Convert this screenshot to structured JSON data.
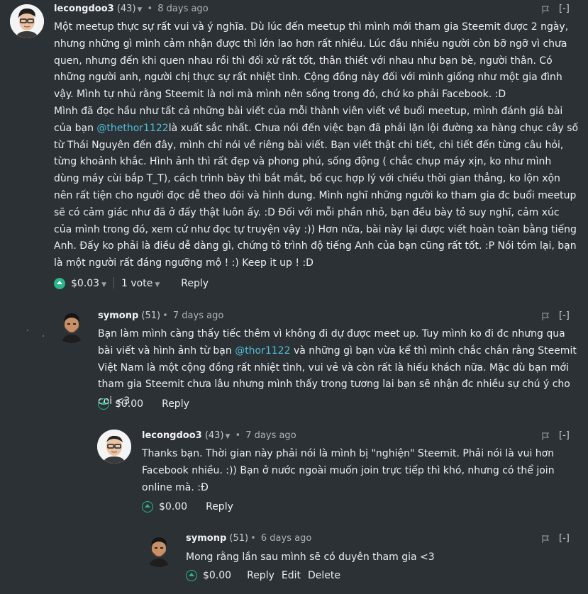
{
  "comments": [
    {
      "author": "lecongdoo3",
      "reputation": "(43)",
      "time": "8 days ago",
      "collapse": "[-]",
      "body": [
        "Một meetup thực sự rất vui và ý nghĩa. Dù lúc đến meetup thì mình mới tham gia Steemit được 2 ngày, nhưng những gì mình cảm nhận được thì lớn lao hơn rất nhiều. Lúc đầu nhiều người còn bỡ ngỡ vì chưa quen, nhưng đến khi quen nhau rồi thì đối xử rất tốt, thân thiết với nhau như bạn bè, người thân. Có những người anh, người chị thực sự rất nhiệt tình. Cộng đồng này đối với mình giống như một gia đình vậy. Mình tự nhủ rằng Steemit là nơi mà mình nên sống trong đó, chứ ko phải Facebook. :D",
        {
          "before": "Mình đã đọc hầu như tất cả những bài viết của mỗi thành viên viết về buổi meetup, mình đánh giá bài của bạn ",
          "mention": "@thethor1122",
          "after": "là xuất sắc nhất. Chưa nói đến việc bạn đã phải lặn lội đường xa hàng chục cây số từ Thái Nguyên đến đây, mình chỉ nói về riêng bài viết. Bạn viết thật chi tiết, chi tiết đến từng câu hỏi, từng khoảnh khắc. Hình ảnh thì rất đẹp và phong phú, sống động ( chắc chụp máy xịn, ko như mình dùng máy cùi bắp T_T), cách trình bày thì bắt mắt, bố cục hợp lý với chiều thời gian thẳng, ko lộn xộn nên rất tiện cho người đọc dễ theo dõi và hình dung. Mình nghĩ những người ko tham gia đc buổi meetup sẽ có cảm giác như đã ở đấy thật luôn ấy. :D Đối với mỗi phần nhỏ, bạn đều bày tỏ suy nghĩ, cảm xúc của mình trong đó, xem cứ như đọc tự truyện vậy :)) Hơn nữa, bài này lại được viết hoàn toàn bằng tiếng Anh. Đấy ko phải là điều dễ dàng gì, chứng tỏ trình độ tiếng Anh của bạn cũng rất tốt. :P Nói tóm lại, bạn là một người rất đáng ngưỡng mộ ! :) Keep it up ! :D"
        }
      ],
      "payout": "$0.03",
      "votes": "1 vote",
      "reply": "Reply"
    },
    {
      "author": "symonp",
      "reputation": "(51)",
      "time": "7 days ago",
      "collapse": "[-]",
      "before": "Bạn làm mình càng thấy tiếc thêm vì không đi dự được meet up. Tuy mình ko đi đc nhưng qua bài viết và hình ảnh từ bạn ",
      "mention": "@thor1122",
      "after": " và những gì bạn vừa kể thì mình chắc chắn rằng Steemit Việt Nam là một cộng đồng rất nhiệt tình, vui vẻ và còn rất là hiếu khách nữa. Mặc dù bạn mới tham gia Steemit chưa lâu nhưng mình thấy trong tương lai bạn sẽ nhận đc nhiều sự chú ý cho coi <3",
      "payout": "$0.00",
      "reply": "Reply"
    },
    {
      "author": "lecongdoo3",
      "reputation": "(43)",
      "time": "7 days ago",
      "collapse": "[-]",
      "text": "Thanks bạn. Thời gian này phải nói là mình bị \"nghiện\" Steemit. Phải nói là vui hơn Facebook nhiều. :)) Bạn ở nước ngoài muốn join trực tiếp thì khó, nhưng có thể join online mà. :Đ",
      "payout": "$0.00",
      "reply": "Reply"
    },
    {
      "author": "symonp",
      "reputation": "(51)",
      "time": "6 days ago",
      "collapse": "[-]",
      "text": "Mong rằng lần sau mình sẽ có duyên tham gia <3",
      "payout": "$0.00",
      "reply": "Reply",
      "edit": "Edit",
      "delete": "Delete"
    }
  ],
  "icons": {
    "flag": "flag-icon",
    "upvote": "upvote-icon",
    "caret": "chevron-down-icon"
  },
  "colors": {
    "background": "#2c3136",
    "mention": "#4fbfd6",
    "upvote": "#2bb58a"
  }
}
